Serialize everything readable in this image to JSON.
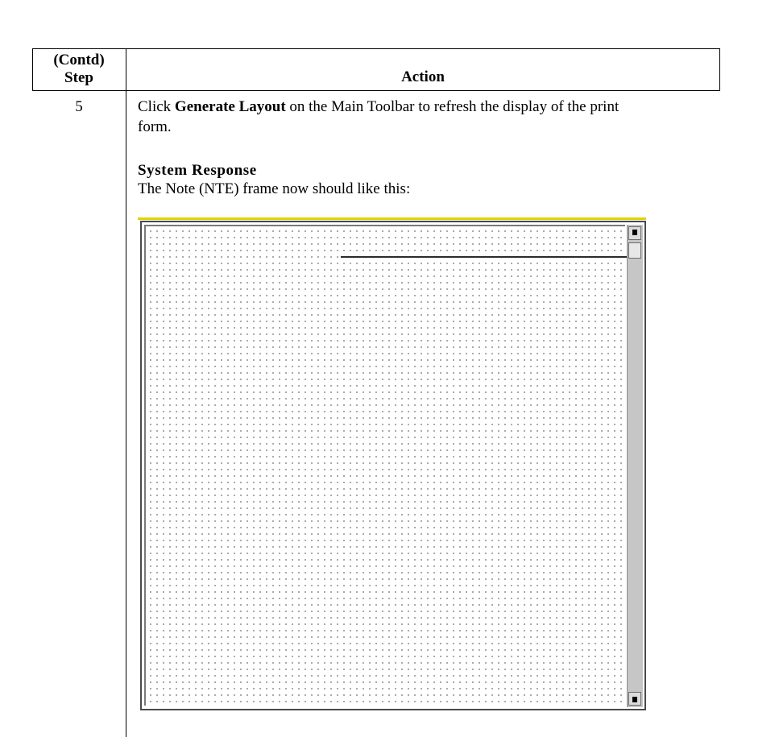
{
  "header": {
    "step_line1": "(Contd)",
    "step_line2": "Step",
    "action": "Action"
  },
  "row": {
    "step": "5",
    "instruction_prefix": "Click ",
    "instruction_bold": "Generate Layout",
    "instruction_suffix": " on the Main Toolbar to refresh the display of the print form.",
    "system_response_heading": "System Response",
    "system_response_text": "The Note (NTE) frame now should like this:"
  },
  "colors": {
    "frame_top_bar": "#e2d200",
    "scrollbar": "#c6c6c6",
    "grid_dots": "#8f8f8f"
  }
}
